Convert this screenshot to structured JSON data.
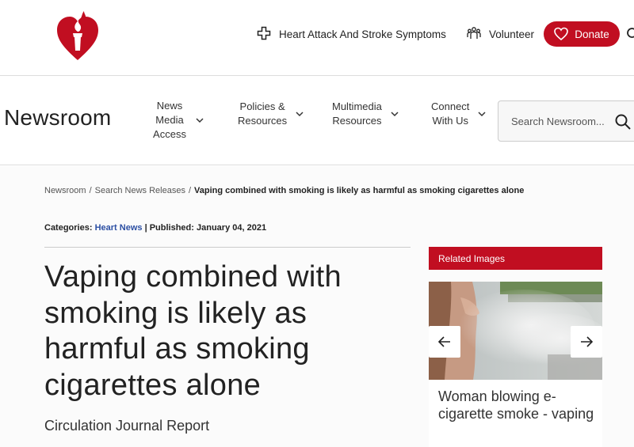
{
  "header": {
    "links": [
      {
        "label": "Heart Attack And Stroke Symptoms",
        "icon": "cross-icon"
      },
      {
        "label": "Volunteer",
        "icon": "volunteer-icon"
      }
    ],
    "donate_label": "Donate",
    "brand_color": "#c10e21"
  },
  "nav": {
    "title": "Newsroom",
    "items": [
      {
        "label_lines": [
          "News",
          "Media",
          "Access"
        ]
      },
      {
        "label_lines": [
          "Policies &",
          "Resources"
        ]
      },
      {
        "label_lines": [
          "Multimedia",
          "Resources"
        ]
      },
      {
        "label_lines": [
          "Connect",
          "With Us"
        ]
      }
    ],
    "search_placeholder": "Search Newsroom..."
  },
  "breadcrumb": {
    "items": [
      "Newsroom",
      "Search News Releases"
    ],
    "current": "Vaping combined with smoking is likely as harmful as smoking cigarettes alone"
  },
  "meta": {
    "categories_label": "Categories:",
    "category": "Heart News",
    "published_label": "| Published: January 04, 2021"
  },
  "article": {
    "headline": "Vaping combined with smoking is likely as harmful as smoking cigarettes alone",
    "subhead": "Circulation Journal Report"
  },
  "related": {
    "header": "Related Images",
    "caption": "Woman blowing e-cigarette smoke - vaping"
  }
}
